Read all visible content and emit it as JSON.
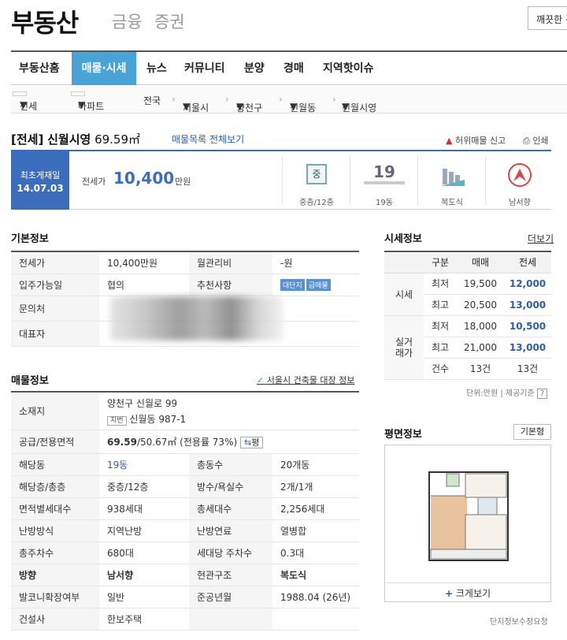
{
  "header": {
    "logo": "부동산",
    "sub_links": [
      "금융",
      "증권"
    ],
    "top_button": "깨끗한 검"
  },
  "gnb": {
    "items": [
      "부동산홈",
      "매물·시세",
      "뉴스",
      "커뮤니티",
      "분양",
      "경매",
      "지역핫이슈"
    ],
    "active": "매물·시세"
  },
  "breadcrumb": {
    "trade": "전세",
    "type": "아파트",
    "levels": [
      "전국",
      "서울시",
      "양천구",
      "신월동",
      "신월시영"
    ]
  },
  "title": {
    "trade": "[전세]",
    "name": "신월시영",
    "area": "69.59㎡",
    "link": "매물목록 전체보기",
    "report": "허위매물 신고",
    "print": "인쇄"
  },
  "summary": {
    "date_label": "최초게재일",
    "date": "14.07.03",
    "price_label": "전세가",
    "price": "10,400",
    "price_unit": "만원",
    "cells": [
      {
        "icon": "floor-icon",
        "glyph": "중",
        "label": "중층/12층"
      },
      {
        "icon": "building-number",
        "glyph": "19",
        "label": "19동"
      },
      {
        "icon": "structure-icon",
        "label": "복도식"
      },
      {
        "icon": "compass-icon",
        "label": "남서향"
      }
    ]
  },
  "basic": {
    "heading": "기본정보",
    "rows": [
      [
        "전세가",
        "10,400만원",
        "월관리비",
        "-원"
      ],
      [
        "입주가능일",
        "협의",
        "추천사항",
        ""
      ],
      [
        "문의처",
        "",
        "",
        ""
      ],
      [
        "대표자",
        "",
        "",
        ""
      ]
    ],
    "badges": [
      "대단지",
      "급매물"
    ]
  },
  "listing": {
    "heading": "매물정보",
    "building_link": "서울시 건축물 대장 정보",
    "address_label": "소재지",
    "address": "양천구 신월로 99",
    "jibun_tag": "지번",
    "jibun": "신월동 987-1",
    "area_label": "공급/전용면적",
    "area_main": "69.59",
    "area_rest": "/50.67㎡ (전용률 73%)",
    "area_btn": "평",
    "rows": [
      [
        "해당동",
        "19동",
        "총동수",
        "20개동"
      ],
      [
        "해당층/총층",
        "중층/12층",
        "방수/욕실수",
        "2개/1개"
      ],
      [
        "면적별세대수",
        "938세대",
        "총세대수",
        "2,256세대"
      ],
      [
        "난방방식",
        "지역난방",
        "난방연료",
        "열병합"
      ],
      [
        "총주차수",
        "680대",
        "세대당 주차수",
        "0.3대"
      ],
      [
        "방향",
        "남서향",
        "현관구조",
        "복도식"
      ],
      [
        "발코니확장여부",
        "일반",
        "준공년월",
        "1988.04 (26년)"
      ],
      [
        "건설사",
        "한보주택",
        "",
        ""
      ]
    ]
  },
  "market": {
    "heading": "시세정보",
    "more": "더보기",
    "cols": [
      "구분",
      "매매",
      "전세"
    ],
    "groups": [
      {
        "name": "시세",
        "rows": [
          [
            "최저",
            "19,500",
            "12,000"
          ],
          [
            "최고",
            "20,500",
            "13,000"
          ]
        ]
      },
      {
        "name": "실거래가",
        "rows": [
          [
            "최저",
            "18,000",
            "10,500"
          ],
          [
            "최고",
            "21,000",
            "13,000"
          ],
          [
            "건수",
            "13건",
            "13건"
          ]
        ]
      }
    ],
    "footer": "단위:만원 | 제공기준",
    "help": "?"
  },
  "floorplan": {
    "heading": "평면정보",
    "tab": "기본형",
    "zoom": "크게보기",
    "footer": "단지정보수정요청"
  },
  "colors": {
    "accent": "#4aa3d7",
    "primary": "#3a6dbb"
  }
}
